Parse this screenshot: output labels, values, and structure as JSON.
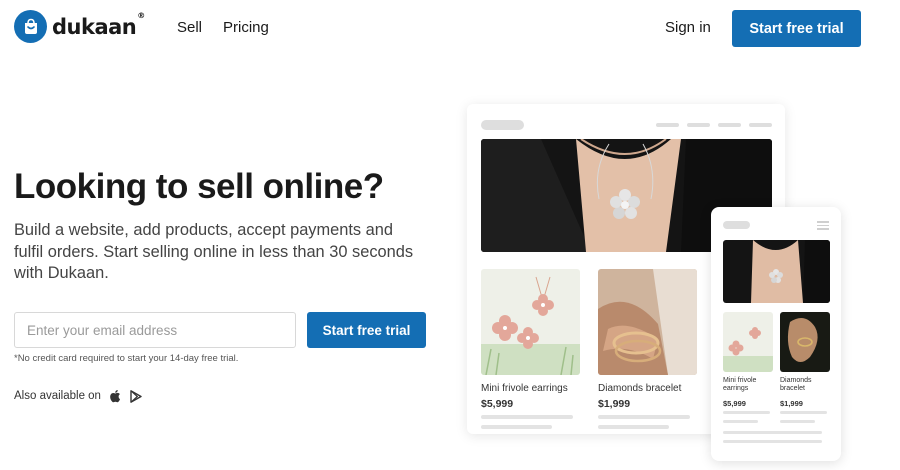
{
  "brand": {
    "name": "dukaan",
    "reg": "®",
    "color": "#146eb4"
  },
  "nav": {
    "links": [
      "Sell",
      "Pricing"
    ],
    "sign_in": "Sign in",
    "cta": "Start free trial"
  },
  "hero": {
    "headline": "Looking to sell online?",
    "subhead": "Build a website, add products, accept payments and fulfil orders. Start selling online in less than 30 seconds with Dukaan.",
    "email_placeholder": "Enter your email address",
    "cta": "Start free trial",
    "note": "*No credit card required to start your 14-day free trial.",
    "also_available": "Also available on",
    "store_icons": [
      "apple-icon",
      "google-play-icon"
    ]
  },
  "mockup": {
    "products": [
      {
        "name": "Mini frivole earrings",
        "price": "$5,999"
      },
      {
        "name": "Diamonds bracelet",
        "price": "$1,999"
      }
    ],
    "phone_products": [
      {
        "name": "Mini frivole earrings",
        "price": "$5,999"
      },
      {
        "name": "Diamonds bracelet",
        "price": "$1,999"
      }
    ]
  }
}
